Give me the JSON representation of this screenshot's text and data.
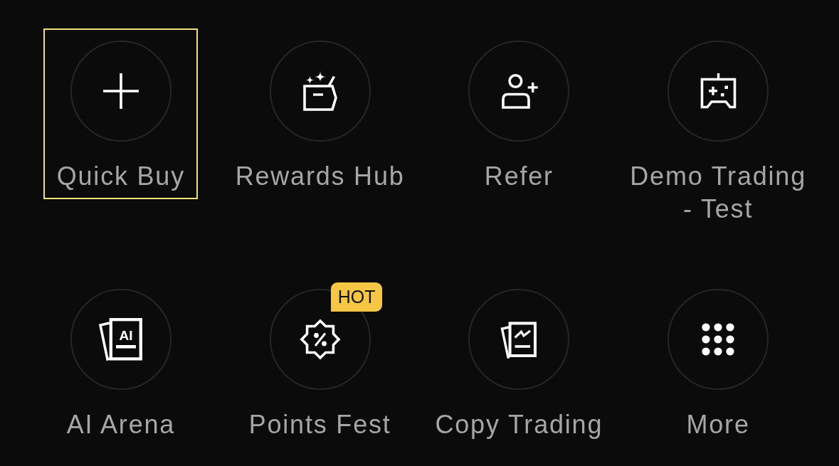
{
  "shortcuts": [
    {
      "label": "Quick Buy",
      "selected": true
    },
    {
      "label": "Rewards Hub",
      "selected": false
    },
    {
      "label": "Refer",
      "selected": false
    },
    {
      "label": "Demo Trading - Test",
      "selected": false
    },
    {
      "label": "AI Arena",
      "selected": false,
      "icon_text": "AI"
    },
    {
      "label": "Points Fest",
      "selected": false,
      "badge": "HOT"
    },
    {
      "label": "Copy Trading",
      "selected": false
    },
    {
      "label": "More",
      "selected": false
    }
  ]
}
